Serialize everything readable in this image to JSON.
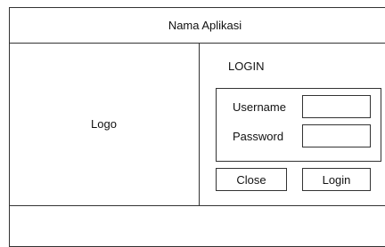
{
  "app": {
    "title": "Nama Aplikasi"
  },
  "logo_panel": {
    "label": "Logo"
  },
  "login": {
    "title": "LOGIN",
    "username_label": "Username",
    "password_label": "Password",
    "username_value": "",
    "password_value": "",
    "close_label": "Close",
    "login_label": "Login"
  }
}
